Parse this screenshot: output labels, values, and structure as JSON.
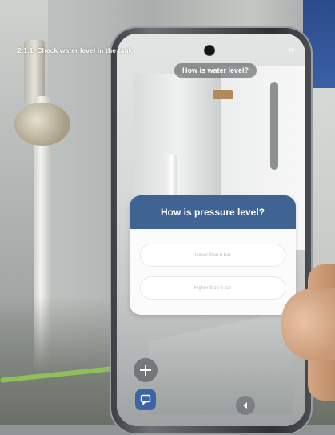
{
  "ar": {
    "step_title": "2.1.1. Check water level in the tank",
    "hint_chip": "How is water level?",
    "close_icon": "close-icon",
    "add_icon": "plus-icon",
    "chat_icon": "chat-icon",
    "nav_icon": "back-icon"
  },
  "dialog": {
    "question": "How is pressure level?",
    "options": [
      "Lower than 6 bar",
      "Higher than 6 bar"
    ]
  },
  "colors": {
    "dialog_header": "#3f6494",
    "chat_button": "#3e64a8",
    "option_text": "#b7bcc6"
  }
}
